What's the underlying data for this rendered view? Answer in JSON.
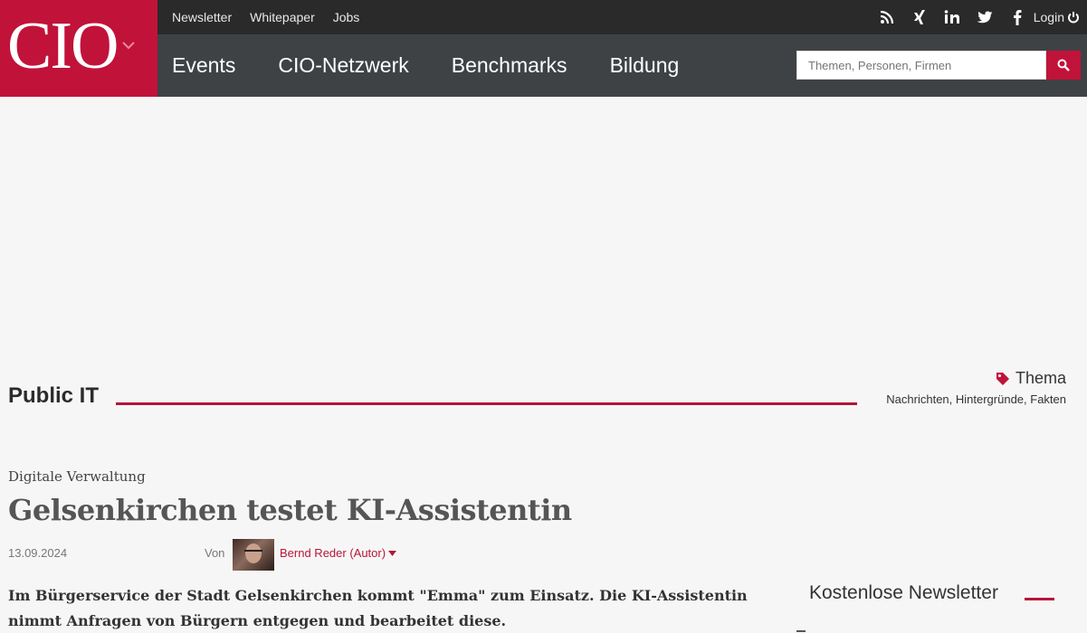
{
  "header": {
    "logo": "CIO",
    "topnav": [
      "Newsletter",
      "Whitepaper",
      "Jobs"
    ],
    "social_icons": [
      "rss-icon",
      "xing-icon",
      "linkedin-icon",
      "twitter-icon",
      "facebook-icon"
    ],
    "login_label": "Login",
    "mainnav": [
      "Events",
      "CIO-Netzwerk",
      "Benchmarks",
      "Bildung"
    ],
    "search_placeholder": "Themen, Personen, Firmen"
  },
  "section": {
    "title": "Public IT",
    "thema_label": "Thema",
    "thema_sub": "Nachrichten, Hintergründe, Fakten"
  },
  "article": {
    "kicker": "Digitale Verwaltung",
    "headline": "Gelsenkirchen testet KI-Assistentin",
    "date": "13.09.2024",
    "by_label": "Von",
    "author": "Bernd Reder (Autor)",
    "teaser": "Im Bürgerservice der Stadt Gelsenkirchen kommt \"Emma\" zum Einsatz. Die KI-Assistentin nimmt Anfragen von Bürgern entgegen und bearbeitet diese."
  },
  "sidebar": {
    "newsletter_title": "Kostenlose Newsletter"
  },
  "colors": {
    "brand": "#c1133a",
    "topbar": "#2a2a2a",
    "mainbar": "#3f4245"
  }
}
